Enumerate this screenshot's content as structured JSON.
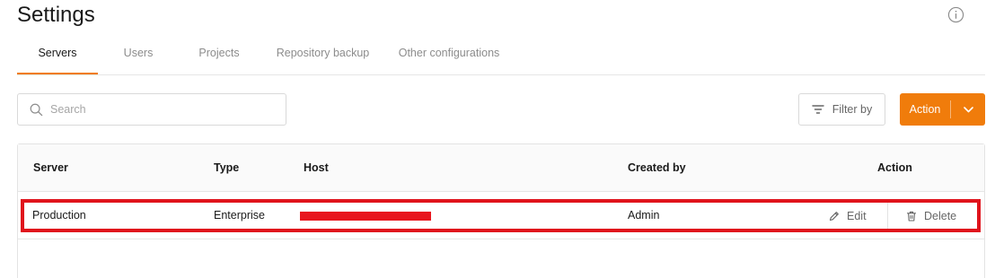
{
  "page": {
    "title": "Settings"
  },
  "tabs": [
    {
      "label": "Servers",
      "active": true
    },
    {
      "label": "Users",
      "active": false
    },
    {
      "label": "Projects",
      "active": false
    },
    {
      "label": "Repository backup",
      "active": false
    },
    {
      "label": "Other configurations",
      "active": false
    }
  ],
  "toolbar": {
    "search_placeholder": "Search",
    "filter_label": "Filter by",
    "action_label": "Action"
  },
  "table": {
    "columns": [
      "Server",
      "Type",
      "Host",
      "Created by",
      "Action"
    ],
    "rows": [
      {
        "server": "Production",
        "type": "Enterprise",
        "host": "",
        "created_by": "Admin",
        "edit_label": "Edit",
        "delete_label": "Delete"
      }
    ]
  },
  "icons": {
    "info": "info-icon",
    "search": "search-icon",
    "filter": "filter-icon",
    "chevron": "chevron-down-icon",
    "edit": "pencil-icon",
    "delete": "trash-icon"
  },
  "colors": {
    "accent": "#f07c0b",
    "highlight": "#e0141c",
    "redaction": "#e8161e"
  }
}
